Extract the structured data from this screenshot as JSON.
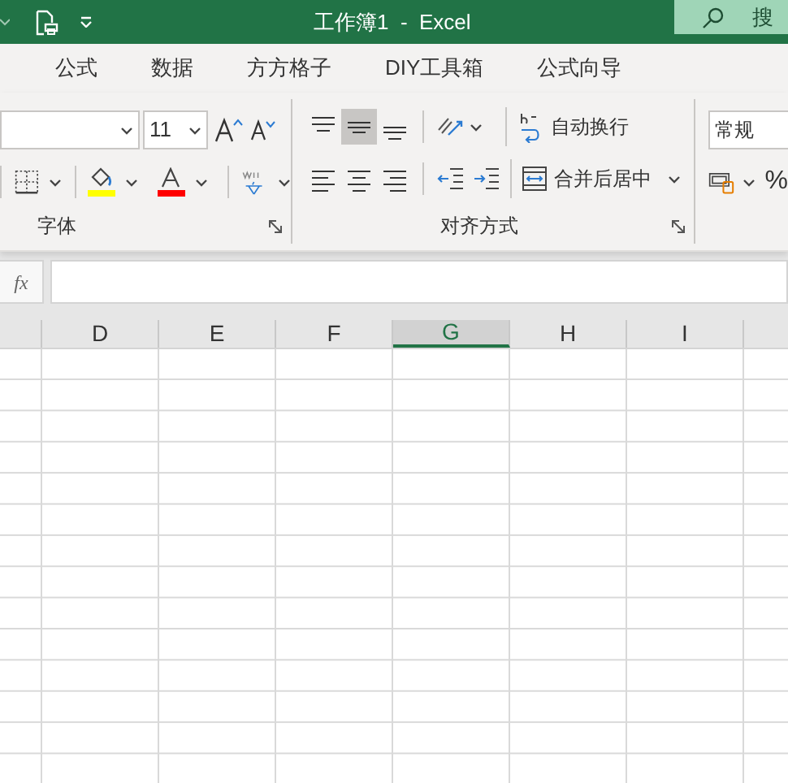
{
  "title_bar": {
    "title": "工作簿1  -  Excel",
    "search_label": "搜"
  },
  "ribbon_tabs": [
    {
      "label": "公式",
      "selected": false
    },
    {
      "label": "数据",
      "selected": false
    },
    {
      "label": "方方格子",
      "selected": false
    },
    {
      "label": "DIY工具箱",
      "selected": false
    },
    {
      "label": "公式向导",
      "selected": false
    }
  ],
  "font_group": {
    "label": "字体",
    "font_size": "11",
    "color_buttons": [
      {
        "kind": "fill",
        "color": "#ffff00"
      },
      {
        "kind": "font",
        "color": "#ff0000"
      }
    ]
  },
  "alignment_group": {
    "label": "对齐方式",
    "wrap_text": "自动换行",
    "merge_center": "合并后居中",
    "vertical_align": [
      {
        "kind": "top",
        "selected": false
      },
      {
        "kind": "middle",
        "selected": true
      },
      {
        "kind": "bottom",
        "selected": false
      }
    ],
    "horizontal_align": [
      {
        "kind": "left",
        "selected": false
      },
      {
        "kind": "center",
        "selected": false
      },
      {
        "kind": "right",
        "selected": false
      }
    ]
  },
  "number_group": {
    "format": "常规",
    "percent": "%"
  },
  "formula_bar": {
    "fx": "fx"
  },
  "columns": [
    {
      "label": "D",
      "selected": false
    },
    {
      "label": "E",
      "selected": false
    },
    {
      "label": "F",
      "selected": false
    },
    {
      "label": "G",
      "selected": true
    },
    {
      "label": "H",
      "selected": false
    },
    {
      "label": "I",
      "selected": false
    }
  ]
}
